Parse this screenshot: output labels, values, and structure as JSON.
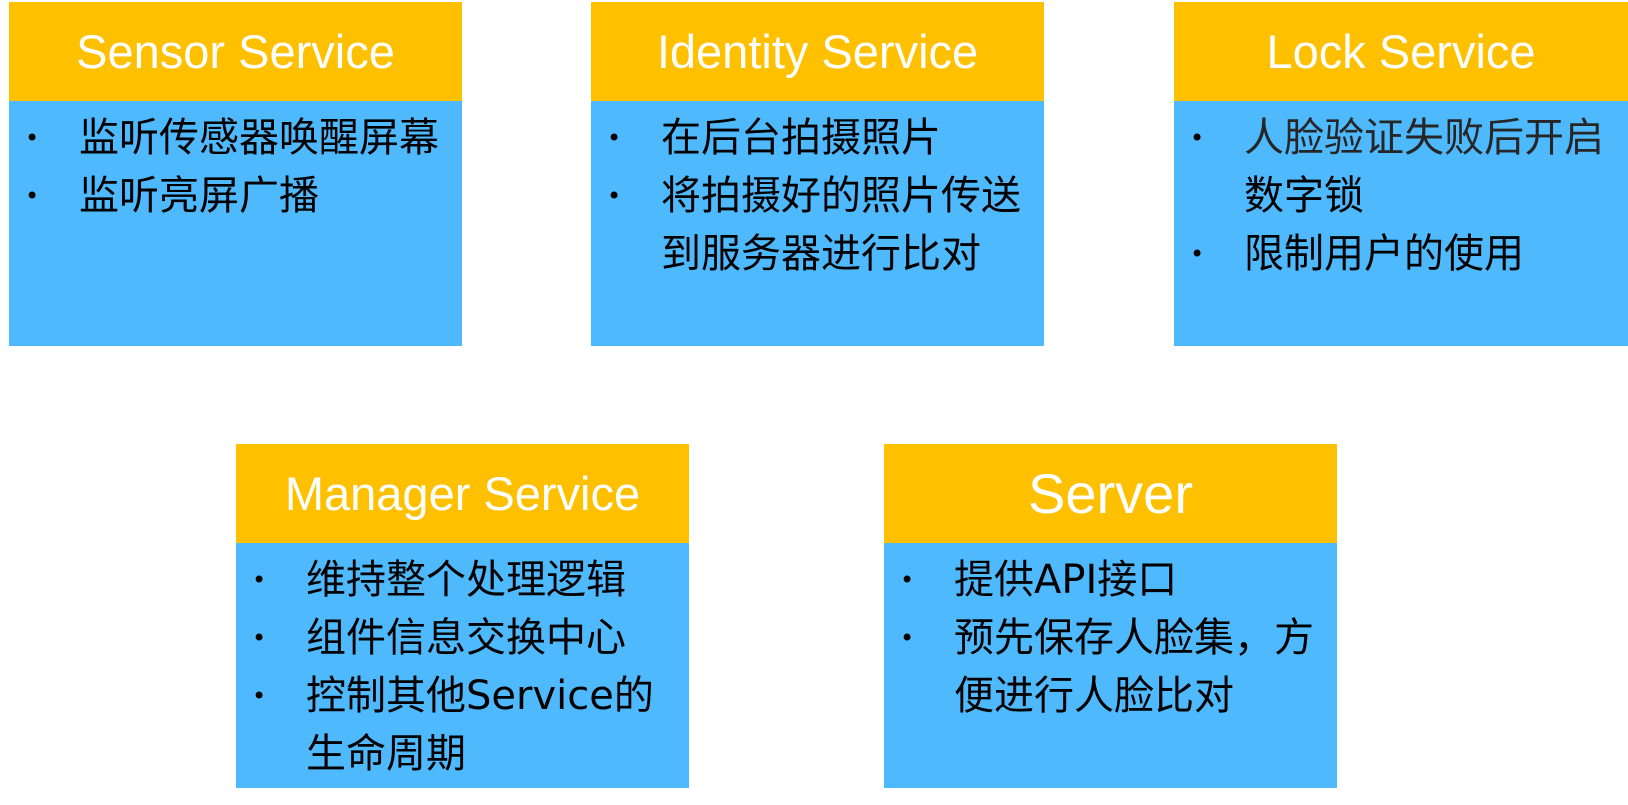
{
  "cards": {
    "sensor": {
      "title": "Sensor Service",
      "items": [
        "监听传感器唤醒屏幕",
        "监听亮屏广播"
      ]
    },
    "identity": {
      "title": "Identity Service",
      "items": [
        "在后台拍摄照片",
        "将拍摄好的照片传送到服务器进行比对"
      ]
    },
    "lock": {
      "title": "Lock Service",
      "item0_part1": "人脸验证失败后开启",
      "item0_part2": "数字锁",
      "items": [
        "人脸验证失败后开启数字锁",
        "限制用户的使用"
      ]
    },
    "manager": {
      "title": "Manager Service",
      "items": [
        "维持整个处理逻辑",
        "组件信息交换中心",
        "控制其他Service的生命周期"
      ]
    },
    "server": {
      "title": "Server",
      "items": [
        "提供API接口",
        "预先保存人脸集，方便进行人脸比对"
      ]
    }
  },
  "bullet_symbol": "•",
  "colors": {
    "header_bg": "#ffc000",
    "header_text": "#ffffff",
    "body_bg": "#4fb9fd",
    "body_text": "#000000"
  }
}
